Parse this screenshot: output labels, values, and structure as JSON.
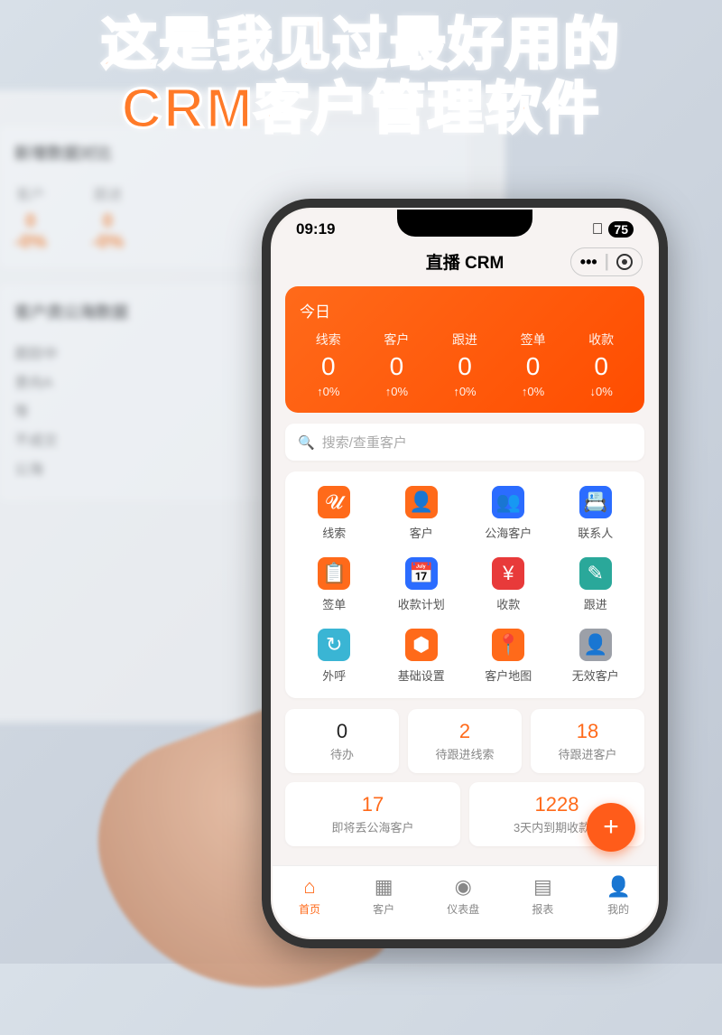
{
  "headline": {
    "line1": "这是我见过最好用的",
    "line2": "CRM客户管理软件"
  },
  "bg": {
    "section1_title": "新增数据对比",
    "s1_labels": [
      "客户",
      "跟进"
    ],
    "s1_val": "0",
    "s1_delta": "-0%",
    "section2_title": "客户类公海数据",
    "list": [
      "跟踪中",
      "意向A",
      "等",
      "不成交",
      "公海"
    ]
  },
  "statusbar": {
    "time": "09:19",
    "battery": "75"
  },
  "app": {
    "title": "直播 CRM"
  },
  "stats": {
    "title": "今日",
    "items": [
      {
        "label": "线索",
        "value": "0",
        "delta": "↑0%"
      },
      {
        "label": "客户",
        "value": "0",
        "delta": "↑0%"
      },
      {
        "label": "跟进",
        "value": "0",
        "delta": "↑0%"
      },
      {
        "label": "签单",
        "value": "0",
        "delta": "↑0%"
      },
      {
        "label": "收款",
        "value": "0",
        "delta": "↓0%"
      }
    ]
  },
  "search": {
    "placeholder": "搜索/查重客户"
  },
  "grid": [
    {
      "label": "线索"
    },
    {
      "label": "客户"
    },
    {
      "label": "公海客户"
    },
    {
      "label": "联系人"
    },
    {
      "label": "签单"
    },
    {
      "label": "收款计划"
    },
    {
      "label": "收款"
    },
    {
      "label": "跟进"
    },
    {
      "label": "外呼"
    },
    {
      "label": "基础设置"
    },
    {
      "label": "客户地图"
    },
    {
      "label": "无效客户"
    }
  ],
  "tiles": [
    {
      "num": "0",
      "label": "待办",
      "color": "black"
    },
    {
      "num": "2",
      "label": "待跟进线索",
      "color": "orange"
    },
    {
      "num": "18",
      "label": "待跟进客户",
      "color": "orange"
    },
    {
      "num": "17",
      "label": "即将丢公海客户",
      "color": "orange"
    },
    {
      "num": "1228",
      "label": "3天内到期收款...",
      "color": "orange"
    }
  ],
  "nav": [
    {
      "label": "首页"
    },
    {
      "label": "客户"
    },
    {
      "label": "仪表盘"
    },
    {
      "label": "报表"
    },
    {
      "label": "我的"
    }
  ]
}
